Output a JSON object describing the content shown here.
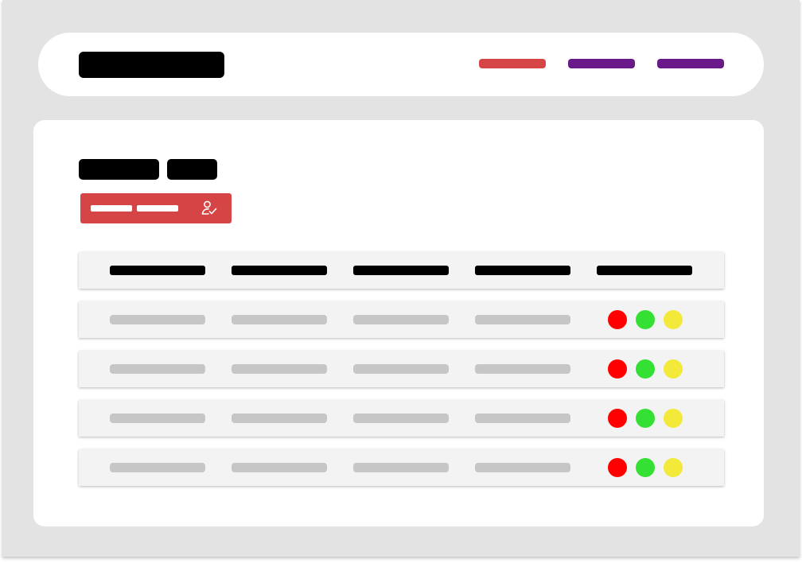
{
  "header": {
    "logo_label": "",
    "nav": [
      {
        "label": "",
        "color": "#d64545"
      },
      {
        "label": "",
        "color": "#6a1a88"
      },
      {
        "label": "",
        "color": "#6a1a88"
      }
    ]
  },
  "main": {
    "title_words": [
      "",
      ""
    ],
    "action_button": {
      "label": "",
      "color": "#d64545",
      "icon": "user-check-icon"
    },
    "table": {
      "columns": [
        "",
        "",
        "",
        "",
        ""
      ],
      "rows": [
        {
          "cells": [
            "",
            "",
            "",
            ""
          ],
          "status": [
            "#ff0000",
            "#33e033",
            "#f2e93a"
          ]
        },
        {
          "cells": [
            "",
            "",
            "",
            ""
          ],
          "status": [
            "#ff0000",
            "#33e033",
            "#f2e93a"
          ]
        },
        {
          "cells": [
            "",
            "",
            "",
            ""
          ],
          "status": [
            "#ff0000",
            "#33e033",
            "#f2e93a"
          ]
        },
        {
          "cells": [
            "",
            "",
            "",
            ""
          ],
          "status": [
            "#ff0000",
            "#33e033",
            "#f2e93a"
          ]
        }
      ]
    }
  }
}
